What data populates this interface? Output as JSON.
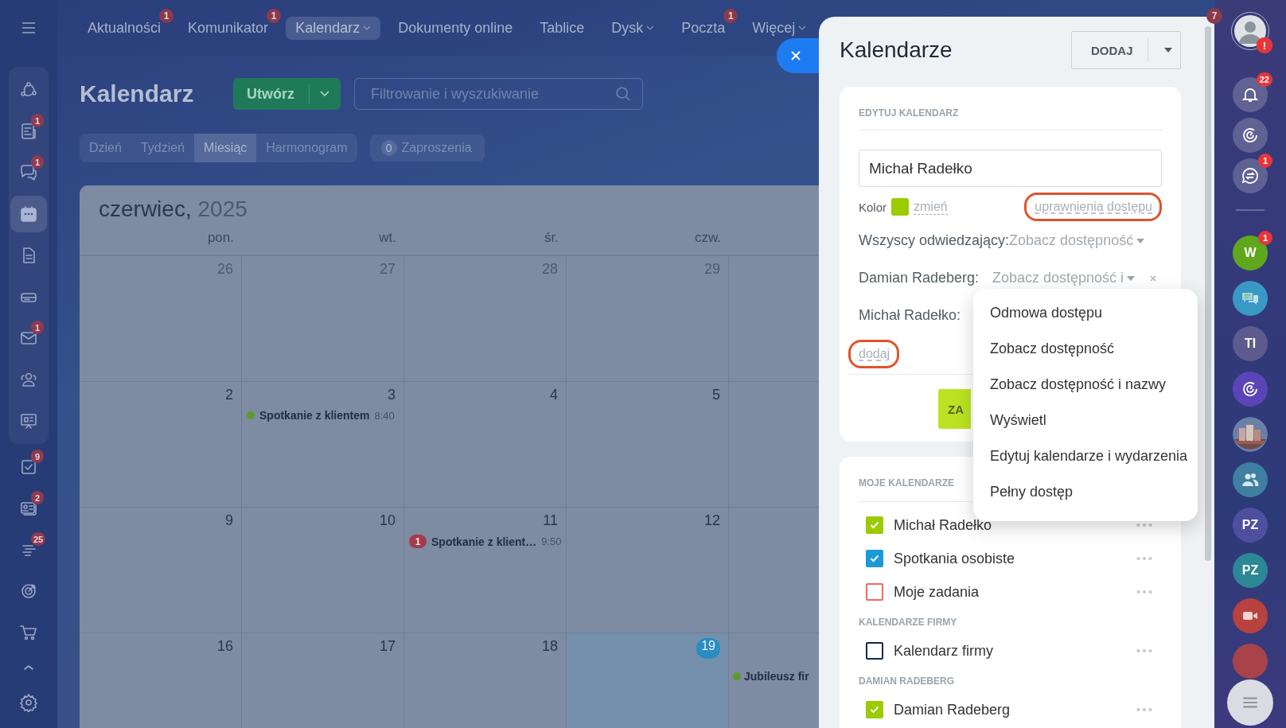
{
  "top_nav": {
    "items": [
      {
        "label": "Aktualności",
        "badge": "1",
        "caret": false,
        "selected": false
      },
      {
        "label": "Komunikator",
        "badge": "1",
        "caret": false,
        "selected": false
      },
      {
        "label": "Kalendarz",
        "caret": true,
        "selected": true
      },
      {
        "label": "Dokumenty online",
        "caret": false,
        "selected": false
      },
      {
        "label": "Tablice",
        "caret": false,
        "selected": false
      },
      {
        "label": "Dysk",
        "caret": true,
        "selected": false
      },
      {
        "label": "Poczta",
        "badge": "1",
        "caret": false,
        "selected": false
      },
      {
        "label": "Więcej",
        "caret": true,
        "selected": false
      }
    ],
    "corner_badge": "7"
  },
  "sidebar": {
    "group_items": [
      {
        "kind": "network",
        "selected": false
      },
      {
        "kind": "news",
        "badge": "1",
        "selected": false
      },
      {
        "kind": "chat",
        "badge": "1",
        "selected": false
      },
      {
        "kind": "calendar",
        "selected": true
      },
      {
        "kind": "document",
        "selected": false
      },
      {
        "kind": "drive",
        "selected": false
      },
      {
        "kind": "mail",
        "badge": "1",
        "selected": false
      },
      {
        "kind": "people",
        "selected": false
      },
      {
        "kind": "board",
        "selected": false
      }
    ],
    "items": [
      {
        "kind": "tasks",
        "badge": "9",
        "selected": false
      },
      {
        "kind": "card",
        "badge": "2",
        "selected": false
      },
      {
        "kind": "stack",
        "badge": "25",
        "selected": false
      },
      {
        "kind": "target",
        "selected": false
      },
      {
        "kind": "cart",
        "selected": false
      },
      {
        "kind": "collapse",
        "selected": false
      }
    ]
  },
  "calendar": {
    "title": "Kalendarz",
    "create_button": "Utwórz",
    "search": {
      "placeholder": "Filtrowanie i wyszukiwanie"
    },
    "views": [
      {
        "label": "Dzień",
        "selected": false
      },
      {
        "label": "Tydzień",
        "selected": false
      },
      {
        "label": "Miesiąc",
        "selected": true
      },
      {
        "label": "Harmonogram",
        "selected": false
      }
    ],
    "invitations": {
      "count": "0",
      "label": "Zaproszenia"
    },
    "month": "czerwiec,",
    "year": "2025",
    "weekdays": [
      "pon.",
      "wt.",
      "śr.",
      "czw."
    ],
    "weeks": [
      [
        {
          "day": "26",
          "other_month": true
        },
        {
          "day": "27",
          "other_month": true
        },
        {
          "day": "28",
          "other_month": true
        },
        {
          "day": "29",
          "other_month": true
        }
      ],
      [
        {
          "day": "2",
          "other_month": false
        },
        {
          "day": "3",
          "other_month": false,
          "events": [
            {
              "title": "Spotkanie z klientem",
              "time": "8:40",
              "color": "#5e9a2a"
            }
          ]
        },
        {
          "day": "4",
          "other_month": false
        },
        {
          "day": "5",
          "other_month": false
        }
      ],
      [
        {
          "day": "9",
          "other_month": false
        },
        {
          "day": "10",
          "other_month": false
        },
        {
          "day": "11",
          "other_month": false,
          "events": [
            {
              "title": "Spotkanie z klient…",
              "time": "9:50",
              "badge": "1"
            }
          ]
        },
        {
          "day": "12",
          "other_month": false
        }
      ],
      [
        {
          "day": "16",
          "other_month": false
        },
        {
          "day": "17",
          "other_month": false
        },
        {
          "day": "18",
          "other_month": false
        },
        {
          "day": "19",
          "today": true
        },
        {
          "events": [
            {
              "title": "Jubileusz fir",
              "color": "#5e9a2a"
            }
          ]
        }
      ]
    ]
  },
  "panel": {
    "title": "Kalendarze",
    "add_button": "DODAJ",
    "edit": {
      "heading": "EDYTUJ KALENDARZ",
      "name_value": "Michał Radełko",
      "color_label": "Kolor",
      "color": "#9bcb00",
      "change_link": "zmień",
      "access_link": {
        "label": "uprawnienia dostępu",
        "highlighted": true
      },
      "access": [
        {
          "who": "Wszyscy odwiedzający:",
          "level": "Zobacz dostępność"
        },
        {
          "who": "Damian Radeberg:",
          "level": "Zobacz dostępność i"
        },
        {
          "who": "Michał Radełko:"
        }
      ],
      "add_link": {
        "label": "dodaj",
        "highlighted": true
      },
      "save_button": "ZA"
    },
    "access_menu": [
      "Odmowa dostępu",
      "Zobacz dostępność",
      "Zobacz dostępność i nazwy",
      "Wyświetl",
      "Edytuj kalendarze i wydarzenia",
      "Pełny dostęp"
    ],
    "lists": [
      {
        "heading": "MOJE KALENDARZE",
        "items": [
          {
            "name": "Michał Radełko",
            "color": "#9bcb00",
            "checked": true
          },
          {
            "name": "Spotkania osobiste",
            "color": "#1a9ad6",
            "checked": true
          },
          {
            "name": "Moje zadania",
            "color": "#f06a5f",
            "checked": false
          }
        ]
      },
      {
        "heading": "KALENDARZE FIRMY",
        "items": [
          {
            "name": "Kalendarz firmy",
            "color": "#102850",
            "checked": false
          }
        ]
      },
      {
        "heading": "DAMIAN RADEBERG",
        "items": [
          {
            "name": "Damian Radeberg",
            "color": "#9bcb00",
            "checked": true
          }
        ]
      }
    ]
  },
  "rail": {
    "top": [
      {
        "kind": "avatar",
        "badge": "!"
      },
      {
        "kind": "bell",
        "badge": "22"
      },
      {
        "kind": "swirl"
      },
      {
        "kind": "chat-arrows",
        "badge": "1"
      }
    ],
    "chats": [
      {
        "kind": "letter",
        "text": "W",
        "color": "#5fa81e",
        "badge": "1"
      },
      {
        "kind": "bubbles",
        "color": "#3a98c4"
      },
      {
        "kind": "letter",
        "text": "TI",
        "color": "#5d5a8e"
      },
      {
        "kind": "swirl",
        "color": "#5b44b8"
      },
      {
        "kind": "picture"
      },
      {
        "kind": "group",
        "color": "#3f7fa2"
      },
      {
        "kind": "letter",
        "text": "PZ",
        "color": "#4f4fa0"
      },
      {
        "kind": "letter",
        "text": "PZ",
        "color": "#2b8894"
      },
      {
        "kind": "video",
        "color": "#b8423e"
      },
      {
        "kind": "letter",
        "color": "#a8434a"
      }
    ]
  }
}
